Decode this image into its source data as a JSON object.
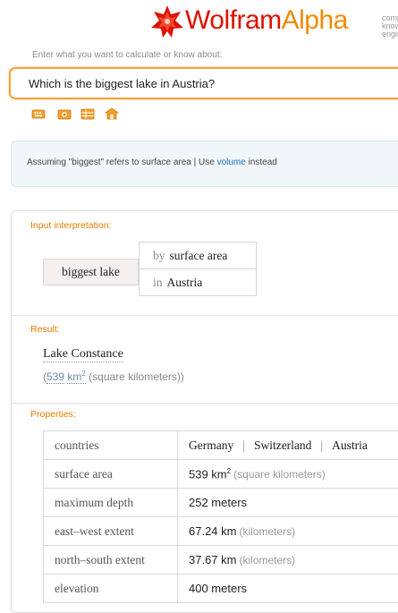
{
  "header": {
    "brand_wolfram": "Wolfram",
    "brand_alpha": "Alpha",
    "tagline": "computational knowledge engine",
    "brand_colors": {
      "wolfram": "#dd1100",
      "alpha": "#f38a00"
    }
  },
  "search": {
    "prompt": "Enter what you want to calculate or know about:",
    "query": "Which is the biggest lake in Austria?"
  },
  "toolbar": {
    "icons": [
      "keyboard-icon",
      "camera-icon",
      "table-icon",
      "examples-icon"
    ]
  },
  "assumption": {
    "prefix": "Assuming \"biggest\" refers to surface area | Use ",
    "link": "volume",
    "suffix": " instead"
  },
  "pods": {
    "input": {
      "title": "Input interpretation:",
      "main": "biggest lake",
      "rows": [
        {
          "qualifier": "by",
          "value": "surface area"
        },
        {
          "qualifier": "in",
          "value": "Austria"
        }
      ]
    },
    "result": {
      "title": "Result:",
      "value": "Lake Constance",
      "open_paren": "(",
      "num": "539",
      "unit": "km",
      "exp": "2",
      "unit_desc": "(square kilometers))"
    },
    "properties": {
      "title": "Properties:",
      "rows": [
        {
          "label": "countries",
          "values": [
            "Germany",
            "Switzerland",
            "Austria"
          ]
        },
        {
          "label": "surface area",
          "value": "539 km",
          "exp": "2",
          "unit": "(square kilometers)"
        },
        {
          "label": "maximum depth",
          "value": "252 meters",
          "unit": ""
        },
        {
          "label": "east–west extent",
          "value": "67.24 km",
          "unit": "(kilometers)"
        },
        {
          "label": "north–south extent",
          "value": "37.67 km",
          "unit": "(kilometers)"
        },
        {
          "label": "elevation",
          "value": "400 meters",
          "unit": ""
        }
      ]
    }
  }
}
